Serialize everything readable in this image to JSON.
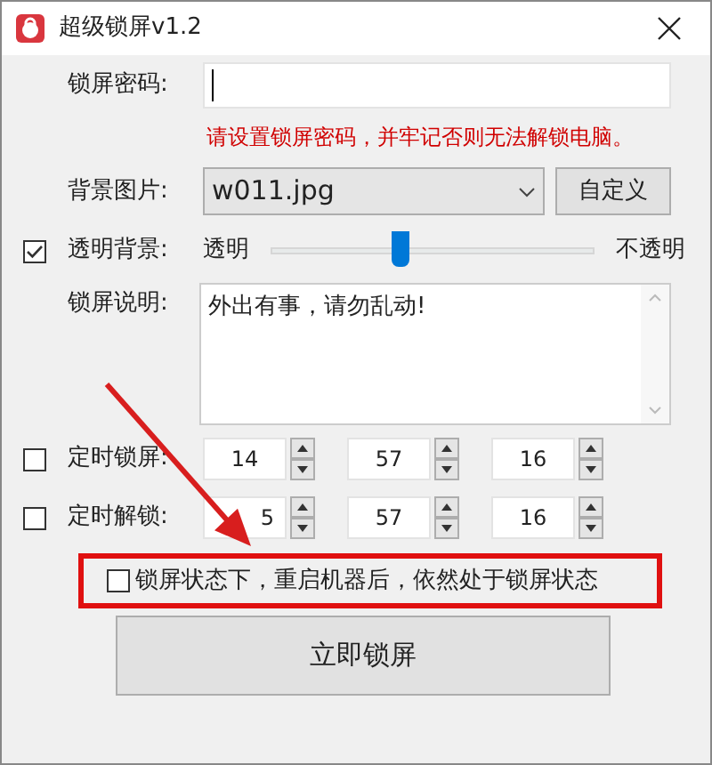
{
  "window": {
    "title": "超级锁屏v1.2"
  },
  "password": {
    "label": "锁屏密码:",
    "hint": "请设置锁屏密码，并牢记否则无法解锁电脑。"
  },
  "background": {
    "label": "背景图片:",
    "value": "w011.jpg",
    "button": "自定义"
  },
  "transparent": {
    "label": "透明背景:",
    "checked": true,
    "min_label": "透明",
    "max_label": "不透明",
    "level": 0.4
  },
  "note": {
    "label": "锁屏说明:",
    "value": "外出有事，请勿乱动!"
  },
  "timers": [
    {
      "label": "定时锁屏:",
      "checked": false,
      "fields": [
        "14",
        "57",
        "16"
      ]
    },
    {
      "label": "定时解锁:",
      "checked": false,
      "fields": [
        "5",
        "57",
        "16"
      ]
    }
  ],
  "persist": {
    "label": "锁屏状态下，重启机器后，依然处于锁屏状态",
    "checked": false
  },
  "lock_button": "立即锁屏"
}
